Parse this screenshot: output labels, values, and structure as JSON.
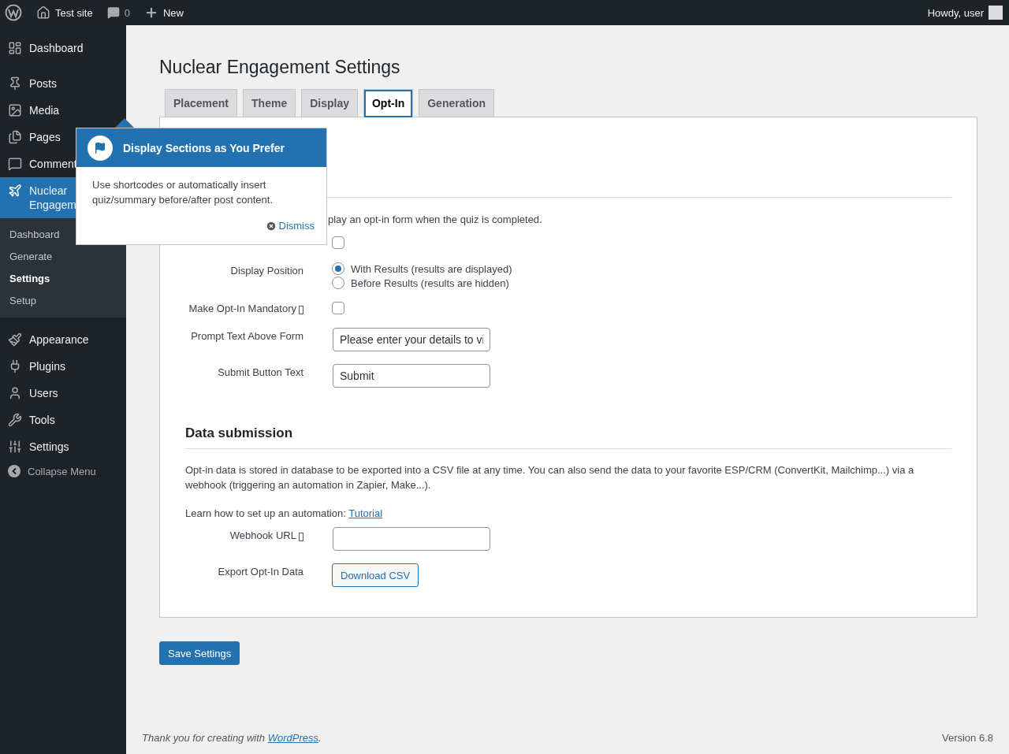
{
  "admin_bar": {
    "site": "Test site",
    "comments": "0",
    "new": "New",
    "greeting": "Howdy, user"
  },
  "sidebar": {
    "items": [
      {
        "label": "Dashboard",
        "selected": false
      },
      {
        "label": "Posts",
        "selected": false
      },
      {
        "label": "Media",
        "selected": false
      },
      {
        "label": "Pages",
        "selected": false
      },
      {
        "label": "Comment",
        "selected": false
      },
      {
        "label": "Nuclear Engagem",
        "selected": true,
        "children": [
          {
            "label": "Dashboard",
            "selected": false
          },
          {
            "label": "Generate",
            "selected": false
          },
          {
            "label": "Settings",
            "selected": true
          },
          {
            "label": "Setup",
            "selected": false
          }
        ]
      },
      {
        "label": "Appearance",
        "selected": false
      },
      {
        "label": "Plugins",
        "selected": false
      },
      {
        "label": "Users",
        "selected": false
      },
      {
        "label": "Tools",
        "selected": false
      },
      {
        "label": "Settings",
        "selected": false
      }
    ],
    "collapse": "Collapse Menu"
  },
  "page_title": "Nuclear Engagement Settings",
  "tabs": [
    {
      "label": "Placement",
      "selected": false
    },
    {
      "label": "Theme",
      "selected": false
    },
    {
      "label": "Display",
      "selected": false
    },
    {
      "label": "Opt-In",
      "selected": true
    },
    {
      "label": "Generation",
      "selected": false
    }
  ],
  "optin_section": {
    "description": "play an opt-in form when the quiz is completed.",
    "fields": [
      {
        "kind": "checkbox",
        "help": false,
        "checked": false
      },
      {
        "kind": "radio",
        "label": "Display Position",
        "help": false,
        "options": [
          {
            "label": "With Results (results are displayed)",
            "selected": true
          },
          {
            "label": "Before Results (results are hidden)",
            "selected": false
          }
        ]
      },
      {
        "kind": "checkbox",
        "label": "Make Opt-In Mandatory",
        "help": true,
        "checked": false
      },
      {
        "kind": "text",
        "label": "Prompt Text Above Form",
        "help": false,
        "value": "Please enter your details to vi"
      },
      {
        "kind": "text",
        "label": "Submit Button Text",
        "help": false,
        "value": "Submit"
      }
    ]
  },
  "data_section": {
    "heading": "Data submission",
    "paragraph": "Opt-in data is stored in database to be exported into a CSV file at any time. You can also send the data to your favorite ESP/CRM (ConvertKit, Mailchimp...) via a webhook (triggering an automation in Zapier, Make...).",
    "learn": "Learn how to set up an automation:",
    "learn_link": "Tutorial",
    "fields": [
      {
        "kind": "text",
        "label": "Webhook URL",
        "help": true
      },
      {
        "kind": "button",
        "label": "Export Opt-In Data",
        "help": false,
        "button": "Download CSV"
      }
    ]
  },
  "save_button": "Save Settings",
  "popover": {
    "title": "Display Sections as You Prefer",
    "body": "Use shortcodes or automatically insert quiz/summary before/after post content.",
    "dismiss": "Dismiss"
  },
  "footer": {
    "thanks": "Thank you for creating with",
    "link": "WordPress",
    "after": ".",
    "version": "Version 6.8"
  }
}
